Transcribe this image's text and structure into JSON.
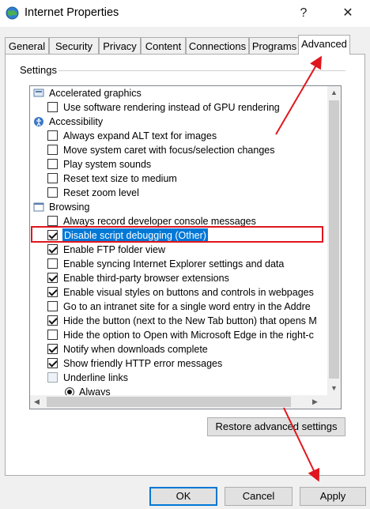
{
  "window": {
    "title": "Internet Properties",
    "help": "?",
    "close": "✕"
  },
  "tabs": [
    {
      "label": "General"
    },
    {
      "label": "Security"
    },
    {
      "label": "Privacy"
    },
    {
      "label": "Content"
    },
    {
      "label": "Connections"
    },
    {
      "label": "Programs"
    },
    {
      "label": "Advanced",
      "active": true
    }
  ],
  "settings_label": "Settings",
  "items": [
    {
      "type": "cat",
      "icon": "screen-icon",
      "label": "Accelerated graphics"
    },
    {
      "type": "check",
      "checked": false,
      "label": "Use software rendering instead of GPU rendering"
    },
    {
      "type": "cat",
      "icon": "accessibility-icon",
      "label": "Accessibility"
    },
    {
      "type": "check",
      "checked": false,
      "label": "Always expand ALT text for images"
    },
    {
      "type": "check",
      "checked": false,
      "label": "Move system caret with focus/selection changes"
    },
    {
      "type": "check",
      "checked": false,
      "label": "Play system sounds"
    },
    {
      "type": "check",
      "checked": false,
      "label": "Reset text size to medium"
    },
    {
      "type": "check",
      "checked": false,
      "label": "Reset zoom level"
    },
    {
      "type": "cat",
      "icon": "browsing-icon",
      "label": "Browsing"
    },
    {
      "type": "check",
      "checked": false,
      "label": "Always record developer console messages"
    },
    {
      "type": "check",
      "checked": true,
      "selected": true,
      "label": "Disable script debugging (Other)"
    },
    {
      "type": "check",
      "checked": true,
      "label": "Enable FTP folder view"
    },
    {
      "type": "check",
      "checked": false,
      "label": "Enable syncing Internet Explorer settings and data"
    },
    {
      "type": "check",
      "checked": true,
      "label": "Enable third-party browser extensions"
    },
    {
      "type": "check",
      "checked": true,
      "label": "Enable visual styles on buttons and controls in webpages"
    },
    {
      "type": "check",
      "checked": false,
      "label": "Go to an intranet site for a single word entry in the Addre"
    },
    {
      "type": "check",
      "checked": true,
      "label": "Hide the button (next to the New Tab button) that opens M"
    },
    {
      "type": "check",
      "checked": false,
      "label": "Hide the option to Open with Microsoft Edge in the right-c"
    },
    {
      "type": "check",
      "checked": true,
      "label": "Notify when downloads complete"
    },
    {
      "type": "check",
      "checked": true,
      "label": "Show friendly HTTP error messages"
    },
    {
      "type": "subcat",
      "label": "Underline links"
    },
    {
      "type": "radio",
      "label": "Always"
    }
  ],
  "scroll": {
    "up": "▲",
    "down": "▼",
    "left": "◀",
    "right": "▶"
  },
  "buttons": {
    "restore": "Restore advanced settings",
    "ok": "OK",
    "cancel": "Cancel",
    "apply": "Apply"
  },
  "colors": {
    "annotation": "#e0161e",
    "selection": "#0078d7"
  }
}
